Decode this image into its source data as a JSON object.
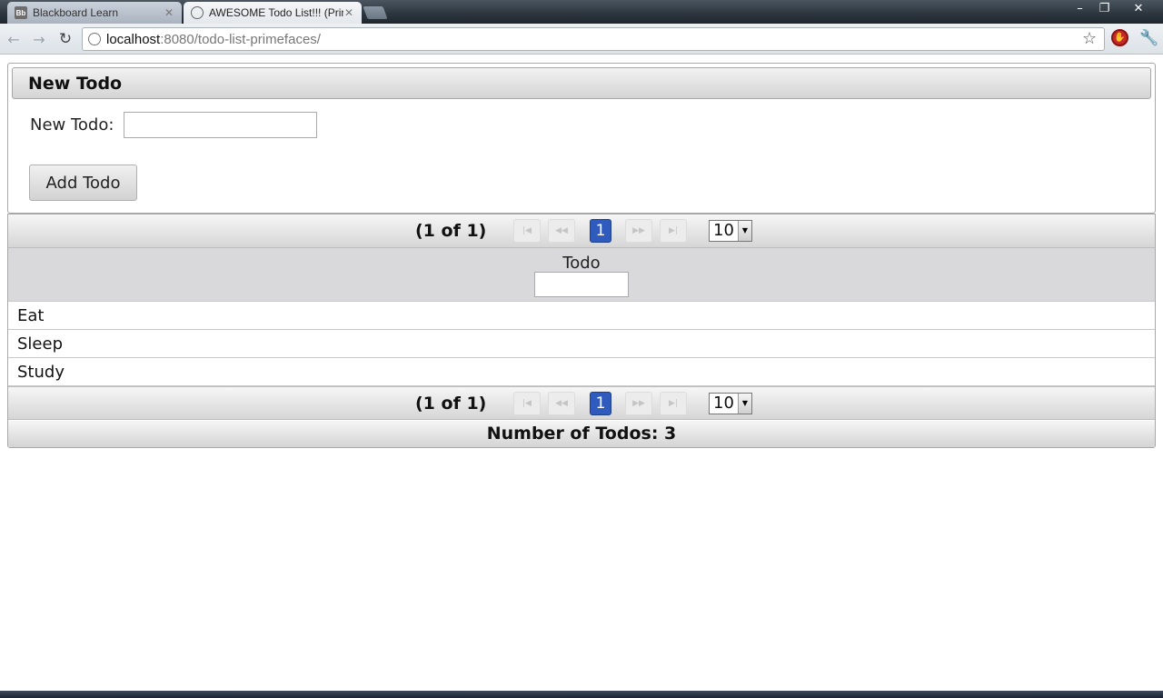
{
  "browser": {
    "tabs": [
      {
        "title": "Blackboard Learn",
        "favicon": "Bb",
        "active": false
      },
      {
        "title": "AWESOME Todo List!!! (Prin",
        "active": true
      }
    ],
    "url_host": "localhost",
    "url_rest": ":8080/todo-list-primefaces/"
  },
  "new_todo": {
    "header": "New Todo",
    "label": "New Todo:",
    "value": "",
    "button": "Add Todo"
  },
  "table": {
    "column_header": "Todo",
    "filter_value": "",
    "rows": [
      "Eat",
      "Sleep",
      "Study"
    ],
    "paginator": {
      "report": "(1 of 1)",
      "current_page": "1",
      "rows_per_page": "10"
    },
    "footer": "Number of Todos: 3"
  },
  "colors": {
    "accent": "#2e5bbd"
  }
}
